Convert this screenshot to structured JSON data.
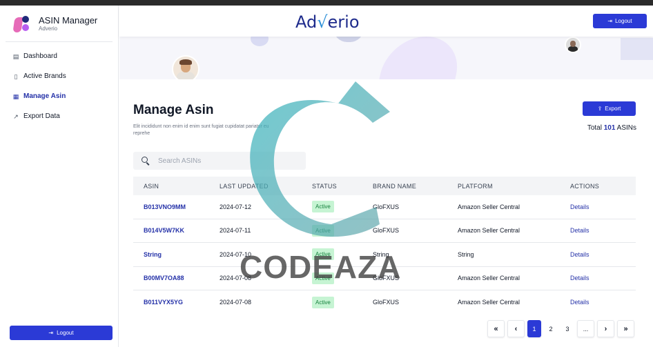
{
  "sidebar": {
    "app_title": "ASIN Manager",
    "app_subtitle": "Adverio",
    "items": [
      {
        "label": "Dashboard",
        "icon": "dashboard-icon"
      },
      {
        "label": "Active Brands",
        "icon": "document-icon"
      },
      {
        "label": "Manage Asin",
        "icon": "grid-icon",
        "active": true
      },
      {
        "label": "Export Data",
        "icon": "external-link-icon"
      }
    ],
    "logout_label": "Logout"
  },
  "header": {
    "logo_part1": "Ad",
    "logo_part2": "√",
    "logo_part3": "erio",
    "logout_label": "Logout"
  },
  "main": {
    "title": "Manage Asin",
    "description": "Elit incididunt non enim id enim sunt fugiat cupidatat pariatur eu reprehe",
    "export_label": "Export",
    "total_prefix": "Total",
    "total_count": "101",
    "total_suffix": "ASINs",
    "search_placeholder": "Search ASINs"
  },
  "table": {
    "headers": [
      "ASIN",
      "LAST UPDATED",
      "STATUS",
      "BRAND NAME",
      "PLATFORM",
      "ACTIONS"
    ],
    "rows": [
      {
        "asin": "B013VNO9MM",
        "updated": "2024-07-12",
        "status": "Active",
        "brand": "GloFXUS",
        "platform": "Amazon Seller Central",
        "action": "Details"
      },
      {
        "asin": "B014V5W7KK",
        "updated": "2024-07-11",
        "status": "Active",
        "brand": "GloFXUS",
        "platform": "Amazon Seller Central",
        "action": "Details"
      },
      {
        "asin": "String",
        "updated": "2024-07-10",
        "status": "Active",
        "brand": "String",
        "platform": "String",
        "action": "Details"
      },
      {
        "asin": "B00MV7OA88",
        "updated": "2024-07-08",
        "status": "Active",
        "brand": "GloFXUS",
        "platform": "Amazon Seller Central",
        "action": "Details"
      },
      {
        "asin": "B011VYX5YG",
        "updated": "2024-07-08",
        "status": "Active",
        "brand": "GloFXUS",
        "platform": "Amazon Seller Central",
        "action": "Details"
      }
    ]
  },
  "pagination": {
    "first": "«",
    "prev": "‹",
    "pages": [
      "1",
      "2",
      "3"
    ],
    "ellipsis": "...",
    "next": "›",
    "last": "»",
    "current": "1"
  },
  "watermark": {
    "text": "CODEAZA"
  },
  "colors": {
    "primary": "#2b3ad6",
    "link": "#2431a8",
    "badge_bg": "#c6f4d3",
    "badge_text": "#15803d"
  }
}
